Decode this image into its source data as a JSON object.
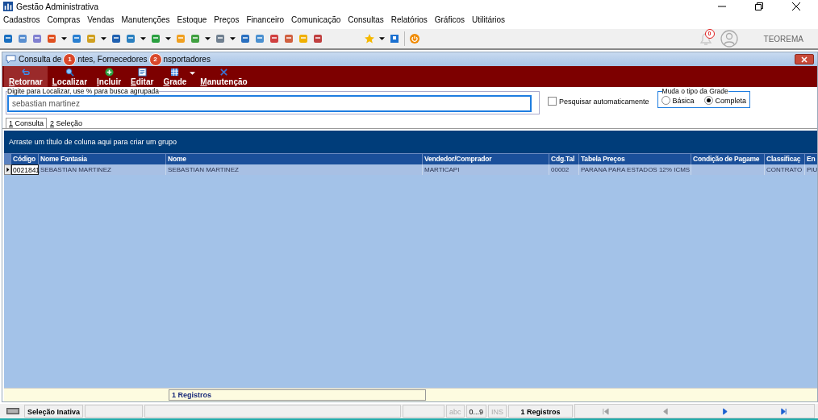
{
  "window": {
    "title": "Gestão Administrativa"
  },
  "menu": [
    "Cadastros",
    "Compras",
    "Vendas",
    "Manutenções",
    "Estoque",
    "Preços",
    "Financeiro",
    "Comunicação",
    "Consultas",
    "Relatórios",
    "Gráficos",
    "Utilitários"
  ],
  "toolbar": {
    "notifications": "0",
    "user": "TEOREMA"
  },
  "child_window": {
    "title_parts": [
      "Consulta de",
      "ntes, Fornecedores",
      "nsportadores"
    ],
    "markers": [
      "1",
      "2"
    ]
  },
  "actions": [
    {
      "label": "Retornar",
      "selected": true
    },
    {
      "label": "Localizar",
      "selected": false
    },
    {
      "label": "Incluir",
      "selected": false
    },
    {
      "label": "Editar",
      "selected": false
    },
    {
      "label": "Grade",
      "selected": false
    },
    {
      "label": "Manutenção",
      "selected": false
    }
  ],
  "search": {
    "legend": "Digite para Localizar, use % para busca agrupada",
    "value": "sebastian martinez",
    "auto_label": "Pesquisar automaticamente",
    "auto_checked": false
  },
  "grid_type": {
    "legend": "Muda o tipo da Grade",
    "options": [
      {
        "label": "Básica",
        "selected": false
      },
      {
        "label": "Completa",
        "selected": true
      }
    ]
  },
  "tabs": [
    {
      "label": "1 Consulta",
      "selected": true
    },
    {
      "label": "2 Seleção",
      "selected": false
    }
  ],
  "table": {
    "group_hint": "Arraste um título de coluna aqui para criar um grupo",
    "columns": [
      "Código",
      "Nome Fantasia",
      "Nome",
      "Vendedor/Comprador",
      "Cdg.Tal",
      "Tabela Preços",
      "Condição de Pagame",
      "Classificaç",
      "En"
    ],
    "rows": [
      {
        "selected": true,
        "cells": [
          "0021841",
          "SEBASTIAN MARTINEZ",
          "SEBASTIAN MARTINEZ",
          "MARTICAPI",
          "00002",
          "PARANA PARA ESTADOS 12% ICMS",
          "",
          "CONTRATO",
          "PIU"
        ]
      }
    ],
    "footer": "1 Registros"
  },
  "status_bar": {
    "selection": "Seleção Inativa",
    "indicators": [
      {
        "label": "abc",
        "active": false
      },
      {
        "label": "0...9",
        "active": true
      },
      {
        "label": "INS",
        "active": false
      }
    ],
    "count": "1 Registros",
    "nav": [
      {
        "kind": "first",
        "disabled": true
      },
      {
        "kind": "prev",
        "disabled": true
      },
      {
        "kind": "next",
        "disabled": false
      },
      {
        "kind": "last",
        "disabled": false
      }
    ]
  }
}
